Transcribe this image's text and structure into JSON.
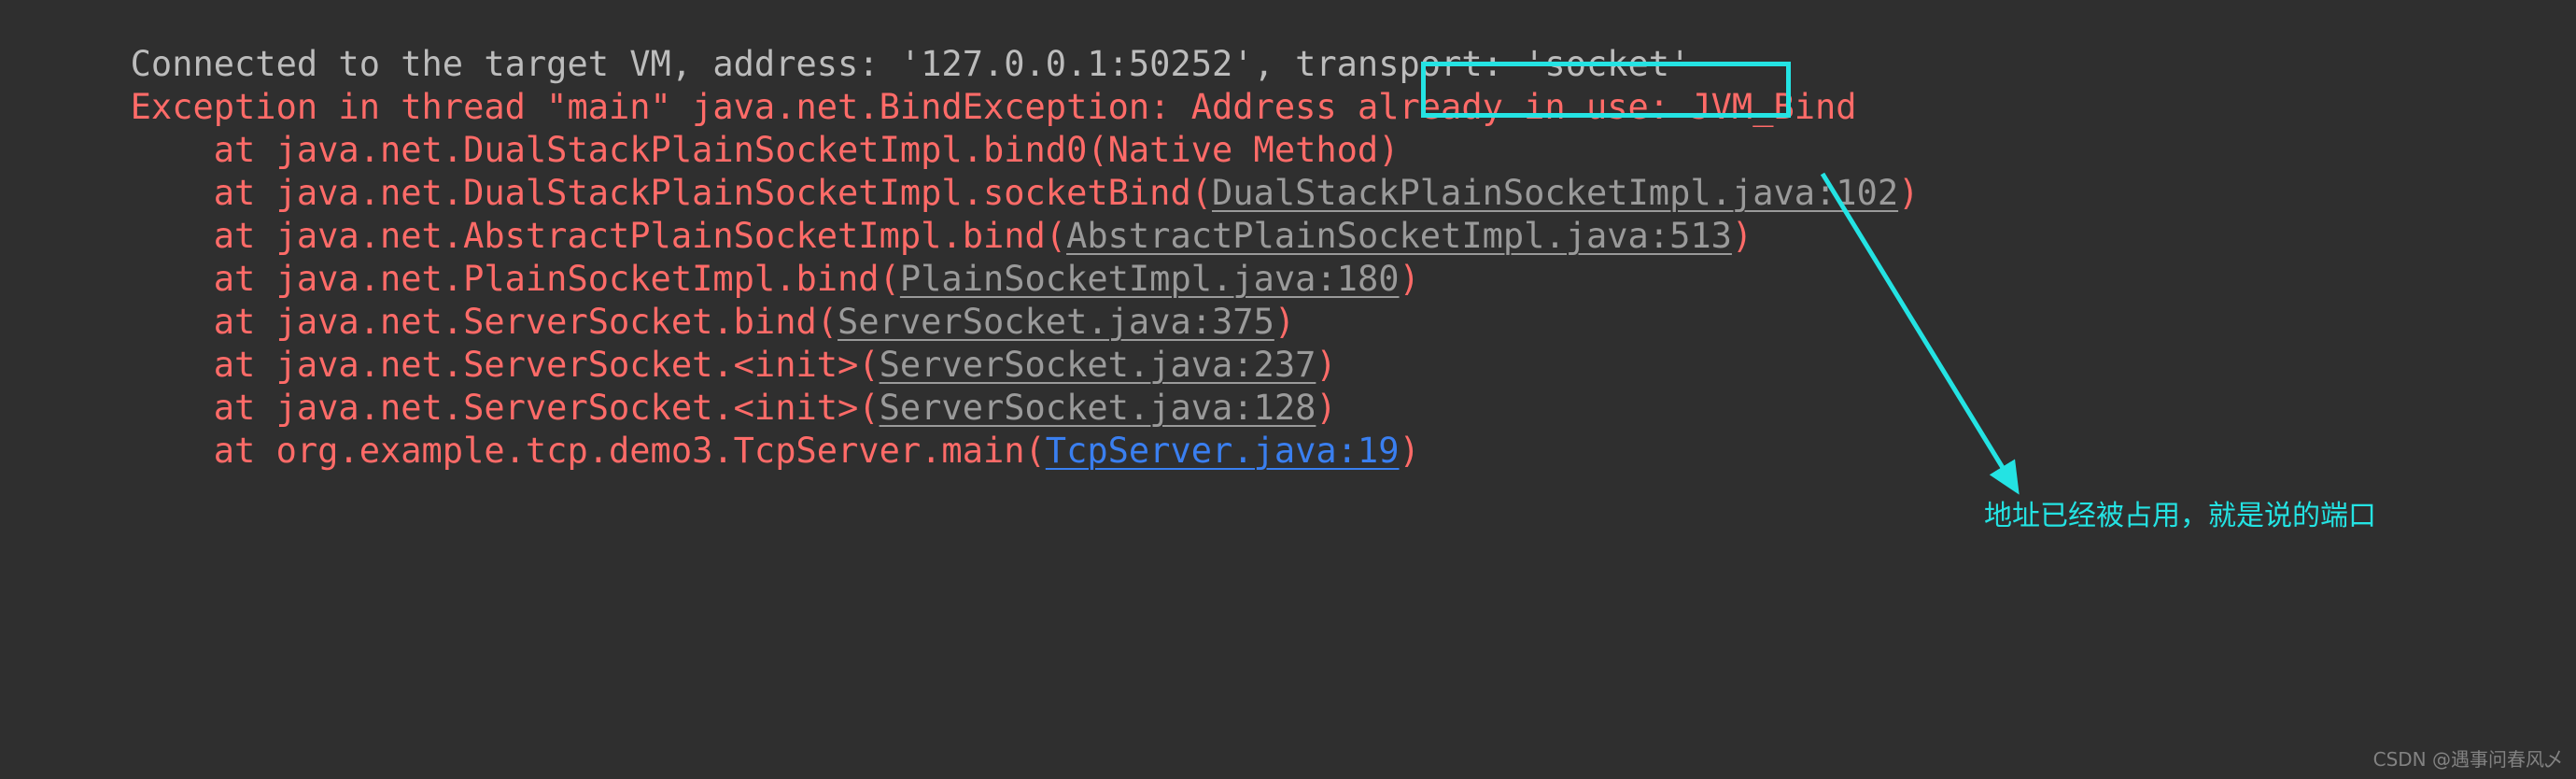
{
  "console": {
    "background_color": "#2f2f2f",
    "info_color": "#bcbcbc",
    "error_color": "#ff6b68",
    "link_color": "#9a9a9a",
    "active_link_color": "#3a7ff0",
    "lines": [
      {
        "kind": "info",
        "text": "Connected to the target VM, address: '127.0.0.1:50252', transport: 'socket'"
      },
      {
        "kind": "error",
        "pre": "Exception in thread \"main\" java.net.BindException: ",
        "highlighted": "Address already in use",
        "post": ": JVM_Bind"
      },
      {
        "kind": "error",
        "text": "    at java.net.DualStackPlainSocketImpl.bind0(Native Method)"
      },
      {
        "kind": "error",
        "pre": "    at java.net.DualStackPlainSocketImpl.socketBind(",
        "link": "DualStackPlainSocketImpl.java:102",
        "link_style": "gray",
        "post": ")"
      },
      {
        "kind": "error",
        "pre": "    at java.net.AbstractPlainSocketImpl.bind(",
        "link": "AbstractPlainSocketImpl.java:513",
        "link_style": "gray",
        "post": ")"
      },
      {
        "kind": "error",
        "pre": "    at java.net.PlainSocketImpl.bind(",
        "link": "PlainSocketImpl.java:180",
        "link_style": "gray",
        "post": ")"
      },
      {
        "kind": "error",
        "pre": "    at java.net.ServerSocket.bind(",
        "link": "ServerSocket.java:375",
        "link_style": "gray",
        "post": ")"
      },
      {
        "kind": "error",
        "pre": "    at java.net.ServerSocket.<init>(",
        "link": "ServerSocket.java:237",
        "link_style": "gray",
        "post": ")"
      },
      {
        "kind": "error",
        "pre": "    at java.net.ServerSocket.<init>(",
        "link": "ServerSocket.java:128",
        "link_style": "gray",
        "post": ")"
      },
      {
        "kind": "error",
        "pre": "    at org.example.tcp.demo3.TcpServer.main(",
        "link": "TcpServer.java:19",
        "link_style": "blue",
        "post": ")"
      }
    ]
  },
  "annotations": {
    "accent_color": "#24e3e3",
    "highlight_target": "Address already in use",
    "note_text": "地址已经被占用，就是说的端口",
    "arrow": "arrow-pointing-down-right"
  },
  "watermark": {
    "text": "CSDN @遇事问春风乄"
  }
}
